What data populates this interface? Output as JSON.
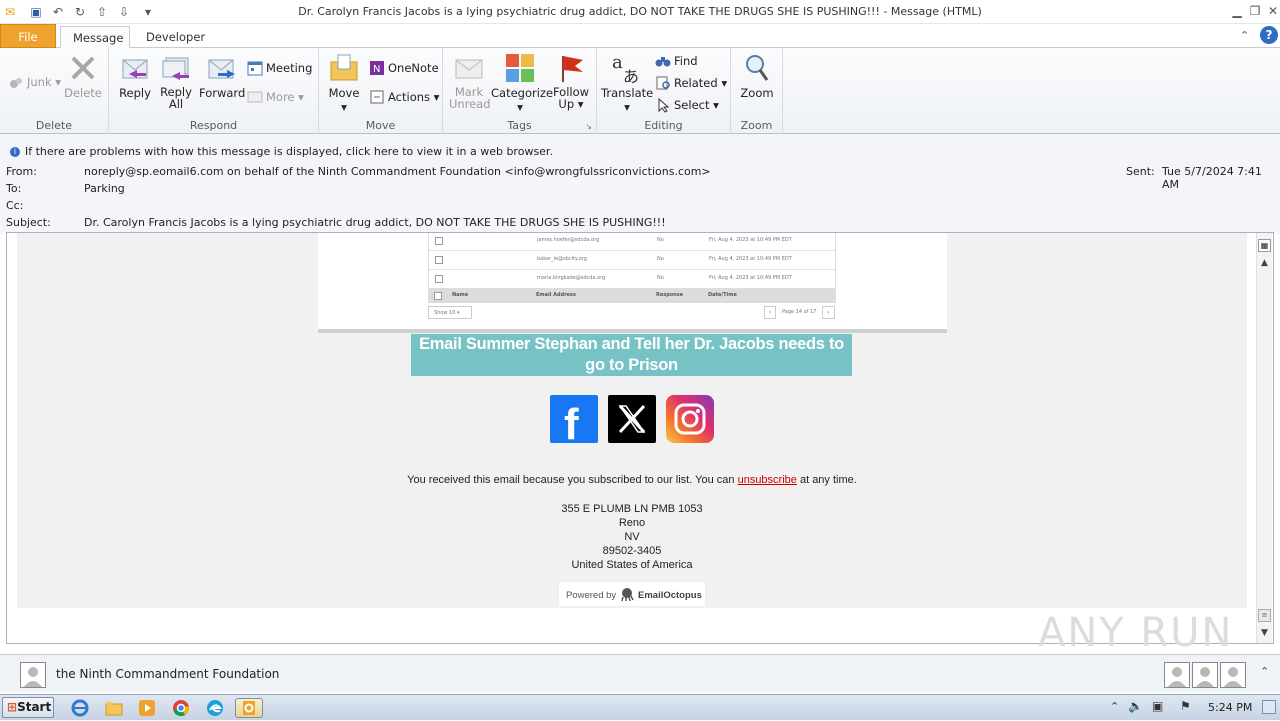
{
  "window": {
    "title": "Dr. Carolyn Francis Jacobs is a lying psychiatric drug addict, DO NOT TAKE THE DRUGS SHE IS PUSHING!!!  -  Message (HTML)"
  },
  "tabs": [
    {
      "label": "File"
    },
    {
      "label": "Message"
    },
    {
      "label": "Developer"
    }
  ],
  "ribbon": {
    "delete_group": {
      "label": "Delete",
      "junk": "Junk",
      "delete": "Delete"
    },
    "respond_group": {
      "label": "Respond",
      "reply": "Reply",
      "reply_all_1": "Reply",
      "reply_all_2": "All",
      "forward": "Forward",
      "meeting": "Meeting",
      "more": "More"
    },
    "move_group": {
      "label": "Move",
      "move": "Move",
      "onenote": "OneNote",
      "actions": "Actions"
    },
    "tags_group": {
      "label": "Tags",
      "mark_unread_1": "Mark",
      "mark_unread_2": "Unread",
      "categorize": "Categorize",
      "follow_up_1": "Follow",
      "follow_up_2": "Up"
    },
    "editing_group": {
      "label": "Editing",
      "translate": "Translate",
      "find": "Find",
      "related": "Related",
      "select": "Select"
    },
    "zoom_group": {
      "label": "Zoom",
      "zoom": "Zoom"
    }
  },
  "header": {
    "info_message": "If there are problems with how this message is displayed, click here to view it in a web browser.",
    "from_label": "From:",
    "from_value": "noreply@sp.eomail6.com on behalf of the Ninth Commandment Foundation <info@wrongfulssriconvictions.com>",
    "to_label": "To:",
    "to_value": "Parking",
    "cc_label": "Cc:",
    "subject_label": "Subject:",
    "subject_value": "Dr. Carolyn Francis Jacobs is a lying psychiatric drug addict, DO NOT TAKE THE DRUGS SHE IS PUSHING!!!",
    "sent_label": "Sent:",
    "sent_value": "Tue 5/7/2024 7:41 AM"
  },
  "email": {
    "table_rows": [
      {
        "email": "james.hoefer@sdcda.org",
        "resp": "No",
        "date": "Fri, Aug 4, 2023 at 10:49 PM EDT"
      },
      {
        "email": "baker_le@sbcity.org",
        "resp": "No",
        "date": "Fri, Aug 4, 2023 at 10:49 PM EDT"
      },
      {
        "email": "maria.kingkade@sdcda.org",
        "resp": "No",
        "date": "Fri, Aug 4, 2023 at 10:49 PM EDT"
      }
    ],
    "table_headers": {
      "name": "Name",
      "email": "Email Address",
      "response": "Response",
      "date": "Date/Time"
    },
    "show_label": "Show 10",
    "page_label": "Page 14 of 17",
    "banner": "Email Summer Stephan and Tell her Dr. Jacobs needs to go to Prison",
    "social": [
      "facebook",
      "x",
      "instagram"
    ],
    "unsub_prefix": "You received this email because you subscribed to our list. You can ",
    "unsub_link": "unsubscribe",
    "unsub_suffix": " at any time.",
    "address": [
      "355 E PLUMB LN PMB 1053",
      "Reno",
      "NV",
      "89502-3405",
      "United States of America"
    ],
    "powered_by": "Powered by",
    "powered_brand": "EmailOctopus"
  },
  "people_pane": {
    "name": "the Ninth Commandment Foundation"
  },
  "taskbar": {
    "start": "Start",
    "time": "5:24 PM"
  },
  "watermark": "ANY RUN"
}
